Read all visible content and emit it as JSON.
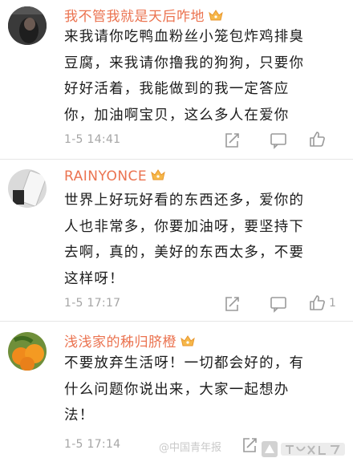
{
  "comments": [
    {
      "username": "我不管我就是天后咋地",
      "lines": [
        "来我请你吃鸭血粉丝小笼包炸鸡排臭",
        "豆腐，来我请你撸我的狗狗，只要你",
        "好好活着，我能做到的我一定答应",
        "你，加油啊宝贝，这么多人在爱你"
      ],
      "time": "1-5 14:41",
      "like_count": ""
    },
    {
      "username": "RAINYONCE",
      "lines": [
        "世界上好玩好看的东西还多，爱你的",
        "人也非常多，你要加油呀，要坚持下",
        "去啊，真的，美好的东西太多，不要",
        "这样呀！"
      ],
      "time": "1-5 17:17",
      "like_count": "1"
    },
    {
      "username": "浅浅家的秭归脐橙",
      "lines": [
        "不要放弃生活呀！一切都会好的，有",
        "什么问题你说出来，大家一起想办",
        "法！"
      ],
      "time": "1-5 17:14",
      "like_count": ""
    }
  ],
  "watermark": "@中国青年报",
  "icons": [
    "crown-badge-icon",
    "share-icon",
    "comment-icon",
    "like-icon"
  ],
  "colors": {
    "username": "#eb7350",
    "meta": "#a5a5a5",
    "text": "#1c1c1c"
  }
}
